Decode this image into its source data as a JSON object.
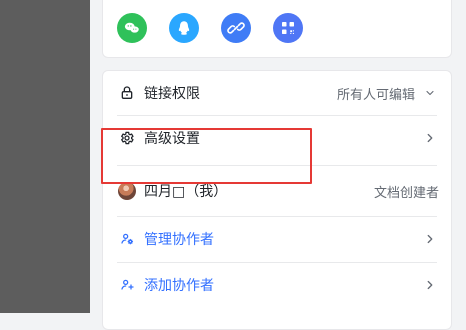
{
  "share_icons": [
    {
      "name": "wechat-icon",
      "color": "#2fc15a"
    },
    {
      "name": "qq-icon",
      "color": "#2aa7ff"
    },
    {
      "name": "link-icon",
      "color": "#3f7cf6"
    },
    {
      "name": "qr-code-icon",
      "color": "#4f76f5"
    }
  ],
  "permissions": {
    "label": "链接权限",
    "value": "所有人可编辑",
    "icon": "lock-icon",
    "chevron": "chevron-down-icon"
  },
  "advanced": {
    "label": "高级设置",
    "icon": "gear-icon",
    "chevron": "chevron-right-icon"
  },
  "owner": {
    "name": "四月□（我）",
    "role": "文档创建者",
    "avatar": "avatar"
  },
  "manage": {
    "label": "管理协作者",
    "icon": "settings-user-icon",
    "chevron": "chevron-right-icon"
  },
  "add": {
    "label": "添加协作者",
    "icon": "add-user-icon",
    "chevron": "chevron-right-icon"
  },
  "colors": {
    "accent_blue": "#3370ff",
    "highlight_red": "#e53935",
    "text_primary": "#1f2329",
    "text_secondary": "#646a73"
  }
}
